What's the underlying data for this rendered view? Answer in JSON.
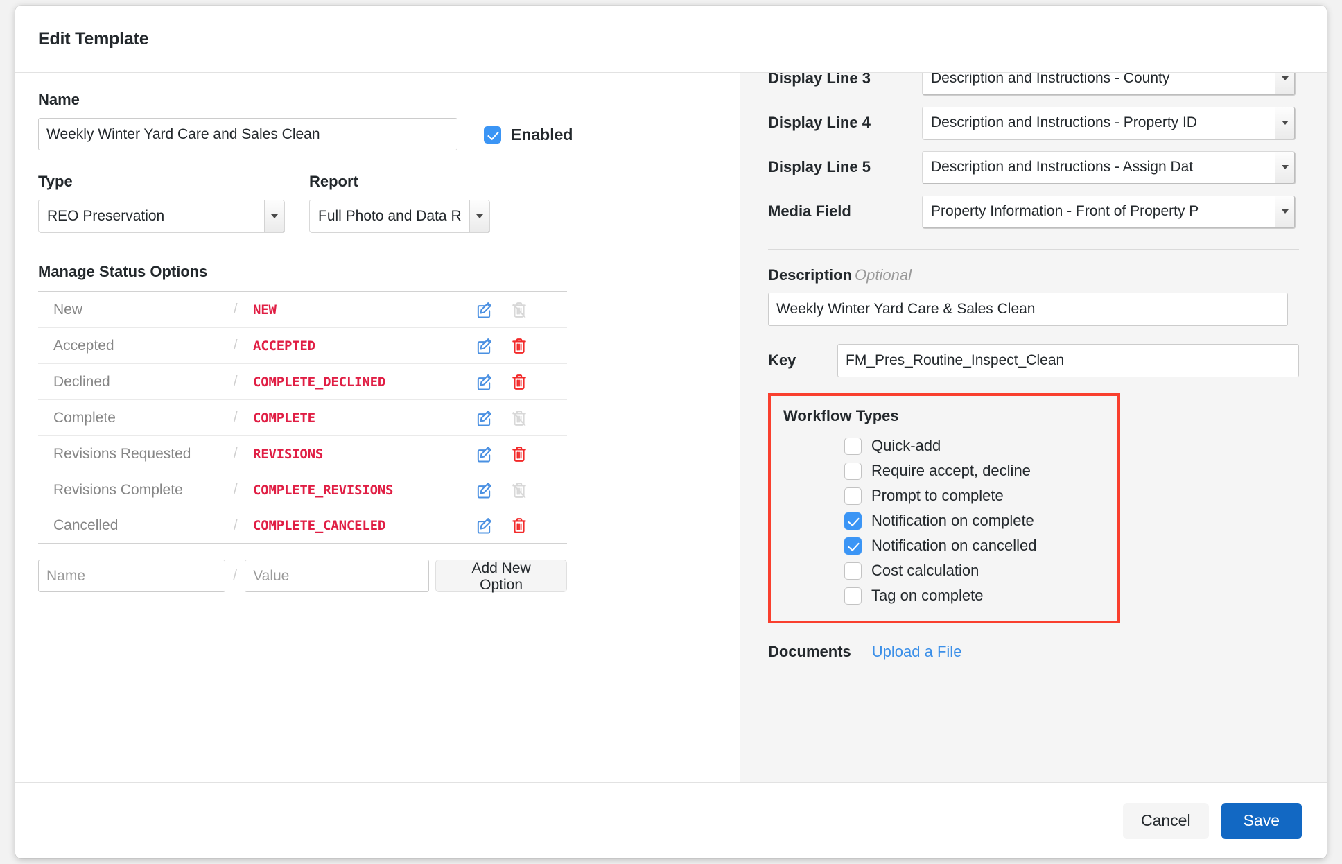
{
  "modal": {
    "title": "Edit Template"
  },
  "left": {
    "name_label": "Name",
    "name_value": "Weekly Winter Yard Care and Sales Clean",
    "enabled_label": "Enabled",
    "enabled_checked": true,
    "type_label": "Type",
    "type_value": "REO Preservation",
    "report_label": "Report",
    "report_value": "Full Photo and Data R",
    "status_section_title": "Manage Status Options",
    "status_rows": [
      {
        "name": "New",
        "separator": "/",
        "value": "NEW",
        "edit_enabled": true,
        "delete_enabled": false
      },
      {
        "name": "Accepted",
        "separator": "/",
        "value": "ACCEPTED",
        "edit_enabled": true,
        "delete_enabled": true
      },
      {
        "name": "Declined",
        "separator": "/",
        "value": "COMPLETE_DECLINED",
        "edit_enabled": true,
        "delete_enabled": true
      },
      {
        "name": "Complete",
        "separator": "/",
        "value": "COMPLETE",
        "edit_enabled": true,
        "delete_enabled": false
      },
      {
        "name": "Revisions Requested",
        "separator": "/",
        "value": "REVISIONS",
        "edit_enabled": true,
        "delete_enabled": true
      },
      {
        "name": "Revisions Complete",
        "separator": "/",
        "value": "COMPLETE_REVISIONS",
        "edit_enabled": true,
        "delete_enabled": false
      },
      {
        "name": "Cancelled",
        "separator": "/",
        "value": "COMPLETE_CANCELED",
        "edit_enabled": true,
        "delete_enabled": true
      }
    ],
    "new_name_placeholder": "Name",
    "new_value_placeholder": "Value",
    "new_separator": "/",
    "add_button_label": "Add New Option"
  },
  "right": {
    "form_fields": [
      {
        "label": "Display Line 3",
        "value": "Description and Instructions - County"
      },
      {
        "label": "Display Line 4",
        "value": "Description and Instructions - Property ID"
      },
      {
        "label": "Display Line 5",
        "value": "Description and Instructions - Assign Dat"
      },
      {
        "label": "Media Field",
        "value": "Property Information - Front of Property P"
      }
    ],
    "description_label": "Description",
    "description_optional": "Optional",
    "description_value": "Weekly Winter Yard Care & Sales Clean",
    "key_label": "Key",
    "key_value": "FM_Pres_Routine_Inspect_Clean",
    "workflow_title": "Workflow Types",
    "workflow_types": [
      {
        "label": "Quick-add",
        "checked": false
      },
      {
        "label": "Require accept, decline",
        "checked": false
      },
      {
        "label": "Prompt to complete",
        "checked": false
      },
      {
        "label": "Notification on complete",
        "checked": true
      },
      {
        "label": "Notification on cancelled",
        "checked": true
      },
      {
        "label": "Cost calculation",
        "checked": false
      },
      {
        "label": "Tag on complete",
        "checked": false
      }
    ],
    "documents_label": "Documents",
    "upload_link_label": "Upload a File"
  },
  "footer": {
    "cancel_label": "Cancel",
    "save_label": "Save"
  },
  "colors": {
    "accent_blue": "#1268c3",
    "checkbox_blue": "#3b95f5",
    "status_value_red": "#e01e44",
    "highlight_red": "#f93f2e",
    "link_blue": "#3b8fe8",
    "panel_gray": "#f5f5f5"
  }
}
